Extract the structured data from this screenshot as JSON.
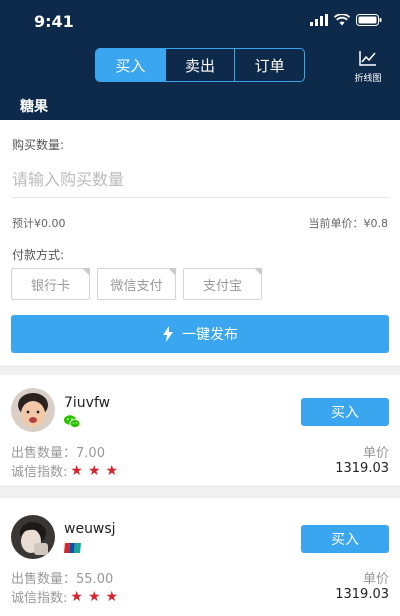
{
  "status_bar": {
    "time": "9:41"
  },
  "nav": {
    "tabs": [
      {
        "label": "买入",
        "active": true
      },
      {
        "label": "卖出",
        "active": false
      },
      {
        "label": "订单",
        "active": false
      }
    ],
    "chart_label": "折线图",
    "coin_tab": "糖果"
  },
  "form": {
    "qty_label": "购买数量:",
    "qty_placeholder": "请输入购买数量",
    "estimate": "预计¥0.00",
    "unit_price": "当前单价：¥0.8",
    "pay_label": "付款方式:",
    "pay_options": [
      "银行卡",
      "微信支付",
      "支付宝"
    ],
    "publish_label": "一键发布"
  },
  "listings": [
    {
      "username": "7iuvfw",
      "pay_icon": "wechat-icon",
      "sell_label": "出售数量：",
      "sell_qty": "7.00",
      "credit_label": "诚信指数:",
      "stars": 3,
      "unit_label": "单价",
      "price": "1319.03",
      "buy_label": "买入"
    },
    {
      "username": "weuwsj",
      "pay_icon": "bank-card-icon",
      "sell_label": "出售数量：",
      "sell_qty": "55.00",
      "credit_label": "诚信指数:",
      "stars": 3,
      "unit_label": "单价",
      "price": "1319.03",
      "buy_label": "买入"
    }
  ],
  "colors": {
    "header_bg": "#0d2a4a",
    "accent": "#3aa6f0",
    "star": "#d9232e"
  }
}
